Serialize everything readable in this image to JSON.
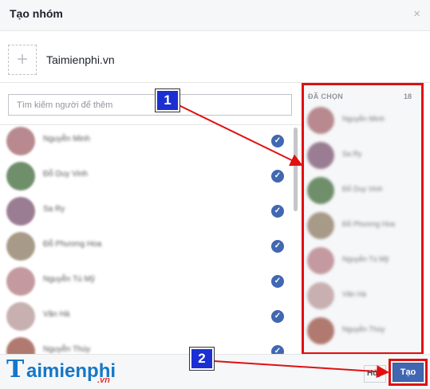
{
  "dialog": {
    "title": "Tạo nhóm",
    "close_glyph": "×"
  },
  "group": {
    "photo_plus": "+",
    "name": "Taimienphi.vn"
  },
  "search": {
    "placeholder": "Tìm kiếm người để thêm"
  },
  "people": [
    {
      "name": "Nguyễn Minh",
      "avatar_color": "#b88a8f",
      "checked": true
    },
    {
      "name": "Đỗ Duy Vinh",
      "avatar_color": "#6f8f6a",
      "checked": true
    },
    {
      "name": "Sa Ry",
      "avatar_color": "#9a7d92",
      "checked": true
    },
    {
      "name": "Đỗ Phương Hoa",
      "avatar_color": "#a89a88",
      "checked": true
    },
    {
      "name": "Nguyễn Tú Mỹ",
      "avatar_color": "#c49aa0",
      "checked": true
    },
    {
      "name": "Văn Hà",
      "avatar_color": "#c8b0b0",
      "checked": true
    },
    {
      "name": "Nguyễn Thúy",
      "avatar_color": "#b07a70",
      "checked": true
    }
  ],
  "check_glyph": "✓",
  "selected": {
    "header": "ĐÃ CHỌN",
    "count": "18",
    "items": [
      {
        "name": "Nguyễn Minh",
        "avatar_color": "#b88a8f"
      },
      {
        "name": "Sa Ry",
        "avatar_color": "#9a7d92"
      },
      {
        "name": "Đỗ Duy Vinh",
        "avatar_color": "#6f8f6a"
      },
      {
        "name": "Đỗ Phương Hoa",
        "avatar_color": "#a89a88"
      },
      {
        "name": "Nguyễn Tú Mỹ",
        "avatar_color": "#c49aa0"
      },
      {
        "name": "Văn Hà",
        "avatar_color": "#c8b0b0"
      },
      {
        "name": "Nguyễn Thúy",
        "avatar_color": "#b07a70"
      }
    ]
  },
  "footer": {
    "logo_t": "T",
    "logo_rest": "aimienphi",
    "logo_vn": ".vn",
    "cancel_label": "Hủy",
    "create_label": "Tạo"
  },
  "annotations": {
    "callout_1": "1",
    "callout_2": "2",
    "highlight_color": "#e01010",
    "callout_color": "#1b2fd3"
  }
}
